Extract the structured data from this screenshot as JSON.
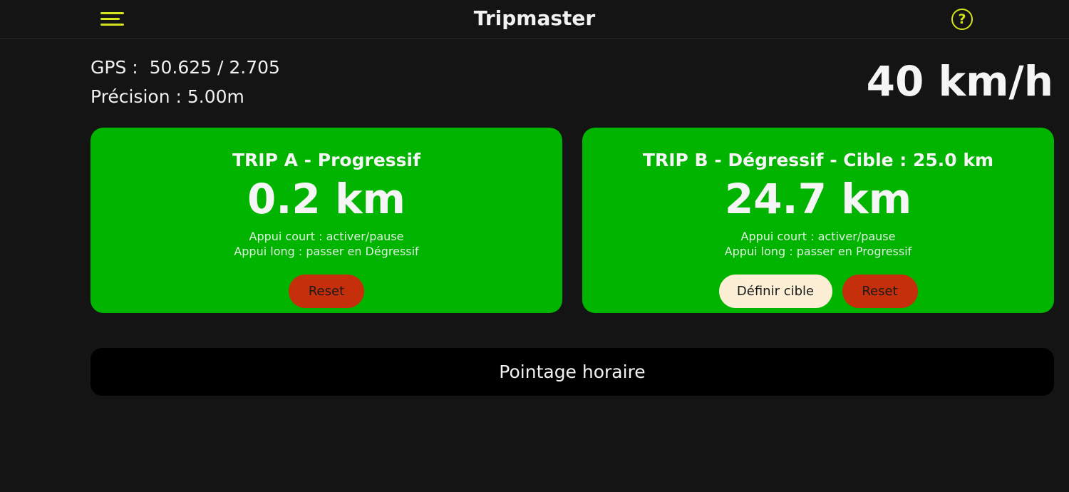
{
  "header": {
    "title": "Tripmaster",
    "menu_icon": "hamburger-menu-icon",
    "help_icon": "question-circle-icon",
    "help_glyph": "?"
  },
  "location": {
    "gps_text": "GPS :  50.625 / 2.705",
    "precision_text": "Précision : 5.00m"
  },
  "speed": {
    "text": "40 km/h"
  },
  "trip_a": {
    "title": "TRIP A - Progressif",
    "distance": "0.2 km",
    "hint_short": "Appui court : activer/pause",
    "hint_long": "Appui long : passer en Dégressif",
    "reset_label": "Reset"
  },
  "trip_b": {
    "title": "TRIP B - Dégressif - Cible : 25.0 km",
    "distance": "24.7 km",
    "hint_short": "Appui court : activer/pause",
    "hint_long": "Appui long : passer en Progressif",
    "target_label": "Définir cible",
    "reset_label": "Reset"
  },
  "pointage": {
    "label": "Pointage horaire"
  },
  "colors": {
    "background": "#141414",
    "accent": "#d4e41a",
    "card_green": "#00b400",
    "reset_red": "#c52f0c",
    "target_cream": "#fcefd6",
    "pointage_black": "#000000"
  }
}
